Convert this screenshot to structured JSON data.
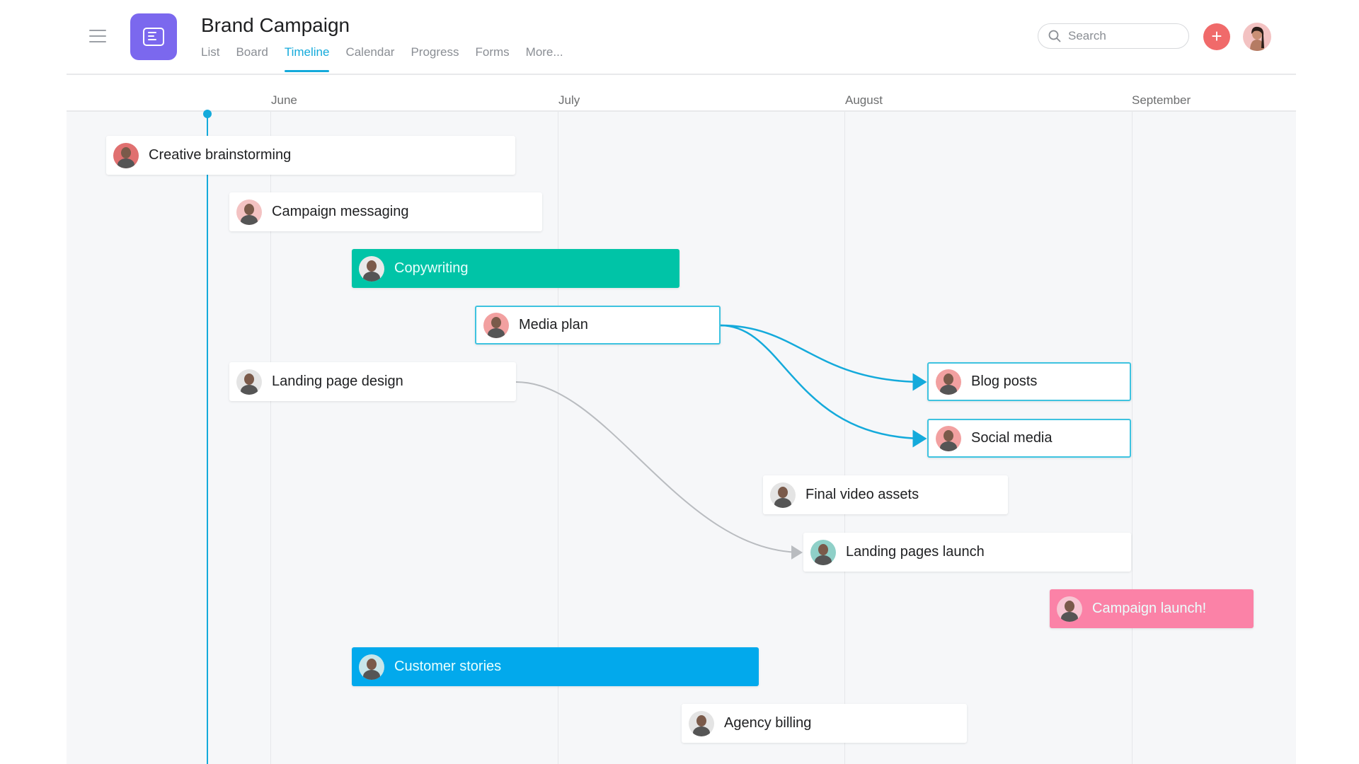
{
  "header": {
    "menu_icon": "hamburger-icon",
    "app_icon": "list-icon",
    "title": "Brand Campaign",
    "tabs": [
      {
        "label": "List",
        "active": false
      },
      {
        "label": "Board",
        "active": false
      },
      {
        "label": "Timeline",
        "active": true
      },
      {
        "label": "Calendar",
        "active": false
      },
      {
        "label": "Progress",
        "active": false
      },
      {
        "label": "Forms",
        "active": false
      },
      {
        "label": "More...",
        "active": false
      }
    ],
    "search": {
      "placeholder": "Search",
      "value": ""
    },
    "add_button": "+"
  },
  "timeline": {
    "months": [
      "June",
      "July",
      "August",
      "September"
    ],
    "tasks": [
      {
        "id": "creative",
        "label": "Creative brainstorming",
        "style": "default",
        "avatar_color": "#e07070"
      },
      {
        "id": "messaging",
        "label": "Campaign messaging",
        "style": "default",
        "avatar_color": "#f3c2c2"
      },
      {
        "id": "copywriting",
        "label": "Copywriting",
        "style": "green",
        "avatar_color": "#e9e9e9"
      },
      {
        "id": "mediaplan",
        "label": "Media plan",
        "style": "selected",
        "avatar_color": "#f2a0a0"
      },
      {
        "id": "landingdesign",
        "label": "Landing page design",
        "style": "default",
        "avatar_color": "#e4e4e4"
      },
      {
        "id": "blog",
        "label": "Blog posts",
        "style": "selected",
        "avatar_color": "#f2a0a0"
      },
      {
        "id": "social",
        "label": "Social media",
        "style": "selected",
        "avatar_color": "#f2a0a0"
      },
      {
        "id": "video",
        "label": "Final video assets",
        "style": "default",
        "avatar_color": "#e4e4e4"
      },
      {
        "id": "landinglaunch",
        "label": "Landing pages launch",
        "style": "default",
        "avatar_color": "#8fd0c8"
      },
      {
        "id": "launch",
        "label": "Campaign launch!",
        "style": "pink",
        "avatar_color": "#f7c6d3"
      },
      {
        "id": "stories",
        "label": "Customer stories",
        "style": "blue",
        "avatar_color": "#c9e6ea"
      },
      {
        "id": "billing",
        "label": "Agency billing",
        "style": "default",
        "avatar_color": "#e4e4e4"
      }
    ],
    "dependencies": [
      {
        "from": "Media plan",
        "to": "Blog posts",
        "color": "#14aadb"
      },
      {
        "from": "Media plan",
        "to": "Social media",
        "color": "#14aadb"
      },
      {
        "from": "Landing page design",
        "to": "Landing pages launch",
        "color": "#b9bcc0"
      }
    ]
  },
  "colors": {
    "accent": "#14aadb",
    "app_icon": "#7b68ee",
    "add_button": "#f06a6a",
    "green_bar": "#00c4a7",
    "blue_bar": "#02a9ec",
    "pink_bar": "#fb82a7"
  }
}
